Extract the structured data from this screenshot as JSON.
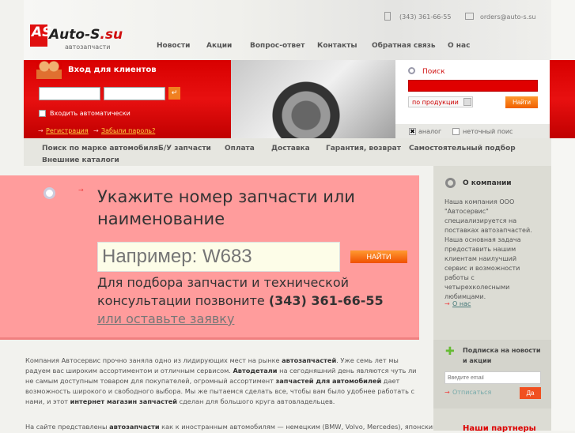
{
  "header": {
    "logo_mark": "AS",
    "logo_name": "Auto-S",
    "logo_tld": ".su",
    "logo_sub": "автозапчасти",
    "phone": "(343) 361-66-55",
    "email": "orders@auto-s.su",
    "nav": [
      "Новости",
      "Акции",
      "Вопрос-ответ",
      "Контакты",
      "Обратная связь",
      "О нас"
    ]
  },
  "login": {
    "title": "Вход для клиентов",
    "auto_login": "Входить автоматически",
    "register": "Регистрация",
    "forgot": "Забыли пароль?",
    "submit_icon": "↵"
  },
  "search": {
    "label": "Поиск",
    "select_value": "по продукции",
    "button": "Найти",
    "analog": "аналог",
    "fuzzy": "неточный поис"
  },
  "nav2": [
    "Поиск по марке автомобиля",
    "Б/У запчасти",
    "Оплата",
    "Доставка",
    "Гарантия, возврат",
    "Самостоятельный подбор",
    "Внешние каталоги"
  ],
  "promo": {
    "title": "Укажите номер запчасти или наименование",
    "placeholder": "Например: W683",
    "button": "НАЙТИ",
    "text": "Для подбора запчасти и технической консультации позвоните",
    "phone": "(343) 361-66-55",
    "link": "или оставьте заявку"
  },
  "body": {
    "p1": [
      "Компания Автосервис прочно заняла одно из лидирующих мест на рынке ",
      "автозапчастей",
      ". Уже семь лет мы радуем вас широким ассортиментом и отличным сервисом. ",
      "Автодетали",
      " на сегодняшний день являются чуть ли не самым доступным товаром для покупателей, огромный ассортимент ",
      "запчастей для автомобилей",
      " дает возможность широкого и свободного выбора. Мы же пытаемся сделать все, чтобы вам было удобнее работать с нами, и этот ",
      "интернет магазин запчастей",
      " сделан для большого круга автовладельцев."
    ],
    "p2": [
      "На сайте представлены ",
      "автозапчасти",
      " как к иностранным автомобилям — немецким (BMW, Volvo, Mercedes), японским"
    ]
  },
  "sidebar": {
    "about_title": "О компании",
    "about_text": "Наша компания ООО \"Автосервис\" специализируется на поставках автозапчастей. Наша основная задача предоставить нашим клиентам наилучший сервис и возможности работы с четырехколесными любимцами.",
    "about_link": "О нас",
    "sub_title": "Подписка на новости и акции",
    "sub_placeholder": "Введите email",
    "unsubscribe": "Отписаться",
    "yes": "Да",
    "partners": "Наши партнеры"
  }
}
